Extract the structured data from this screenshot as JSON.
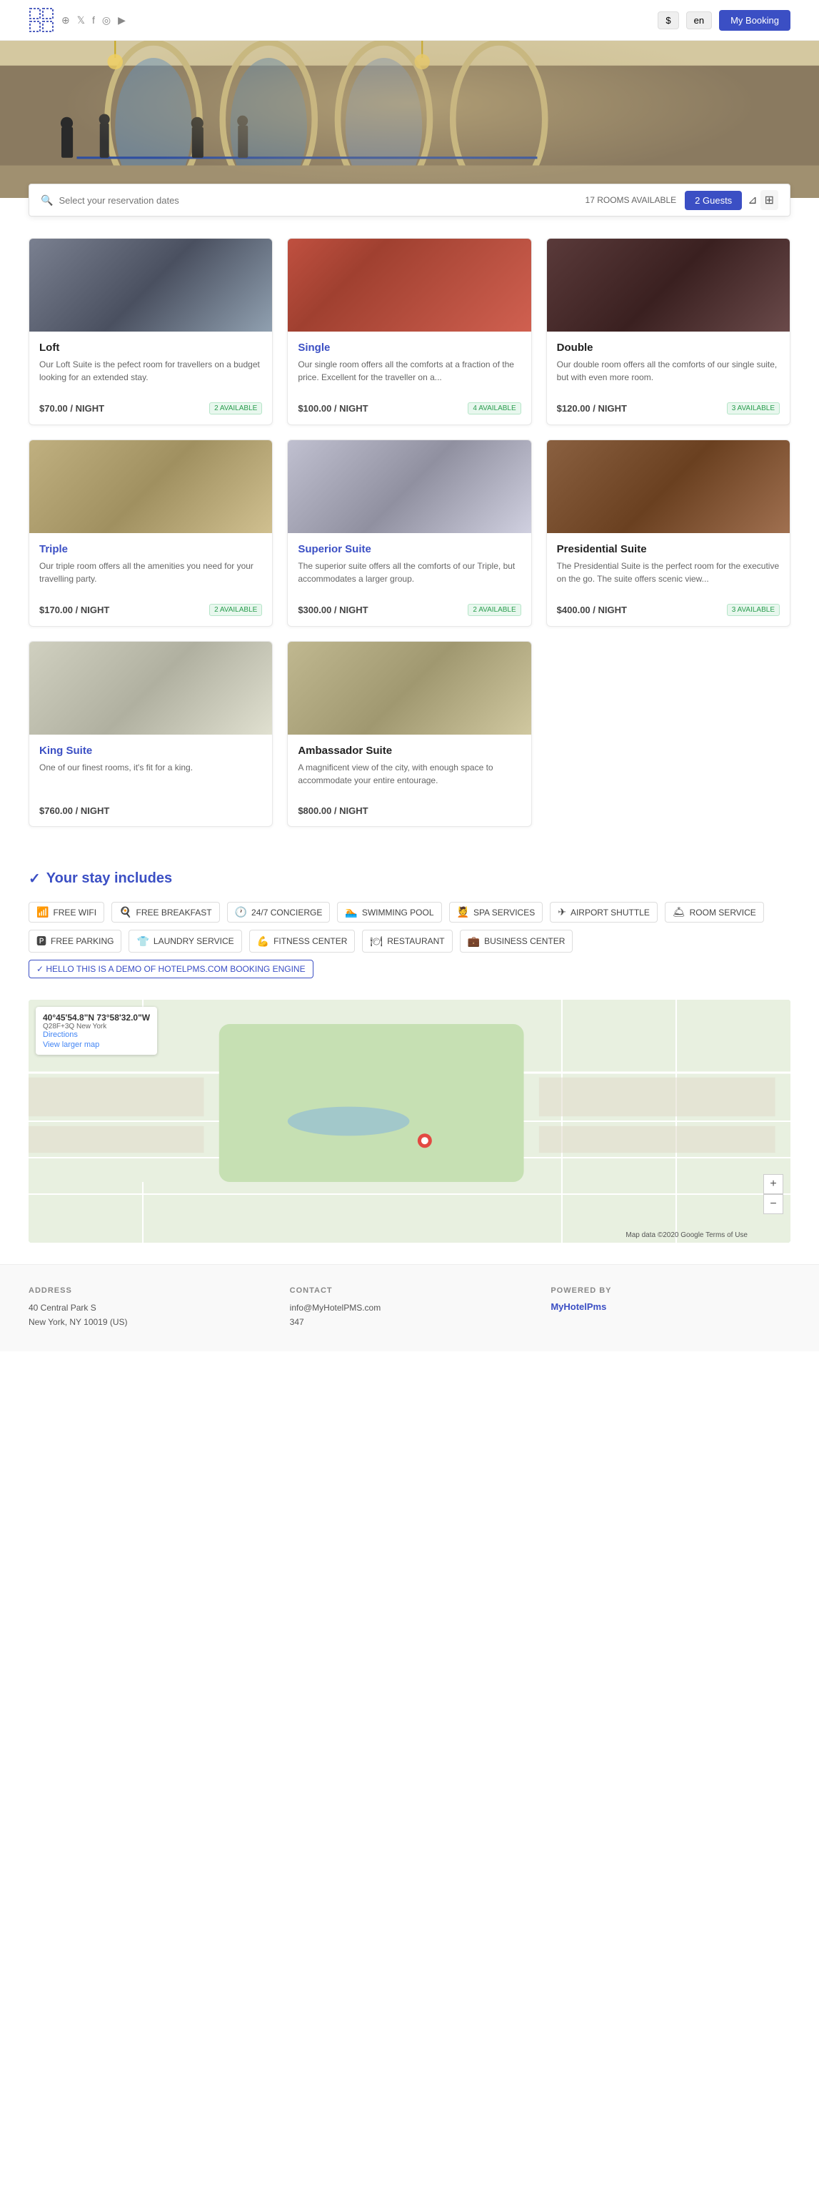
{
  "nav": {
    "currency": "$",
    "language": "en",
    "booking_btn": "My Booking",
    "social_icons": [
      "⊕",
      "𝕏",
      "f",
      "📷",
      "▶"
    ]
  },
  "search": {
    "placeholder": "Select your reservation dates",
    "rooms_available": "17 ROOMS AVAILABLE",
    "guests_btn": "2 Guests"
  },
  "rooms": [
    {
      "id": "loft",
      "title_plain": "Loft",
      "title_link": null,
      "is_link": false,
      "description": "Our Loft Suite is the pefect room for travellers on a budget looking for an extended stay.",
      "price": "$70.00 / NIGHT",
      "available": "2 AVAILABLE",
      "img_class": "img-loft"
    },
    {
      "id": "single",
      "title_plain": null,
      "title_link": "Single",
      "is_link": true,
      "description": "Our single room offers all the comforts at a fraction of the price. Excellent for the traveller on a...",
      "price": "$100.00 / NIGHT",
      "available": "4 AVAILABLE",
      "img_class": "img-single"
    },
    {
      "id": "double",
      "title_plain": "Double",
      "title_link": null,
      "is_link": false,
      "description": "Our double room offers all the comforts of our single suite, but with even more room.",
      "price": "$120.00 / NIGHT",
      "available": "3 AVAILABLE",
      "img_class": "img-double"
    },
    {
      "id": "triple",
      "title_plain": null,
      "title_link": "Triple",
      "is_link": true,
      "description": "Our triple room offers all the amenities you need for your travelling party.",
      "price": "$170.00 / NIGHT",
      "available": "2 AVAILABLE",
      "img_class": "img-triple"
    },
    {
      "id": "superior",
      "title_plain": null,
      "title_link": "Superior Suite",
      "is_link": true,
      "description": "The superior suite offers all the comforts of our Triple, but accommodates a larger group.",
      "price": "$300.00 / NIGHT",
      "available": "2 AVAILABLE",
      "img_class": "img-superior"
    },
    {
      "id": "presidential",
      "title_plain": "Presidential Suite",
      "title_link": null,
      "is_link": false,
      "description": "The Presidential Suite is the perfect room for the executive on the go. The suite offers scenic view...",
      "price": "$400.00 / NIGHT",
      "available": "3 AVAILABLE",
      "img_class": "img-presidential"
    },
    {
      "id": "king",
      "title_plain": null,
      "title_link": "King Suite",
      "is_link": true,
      "description": "One of our finest rooms, it's fit for a king.",
      "price": "$760.00 / NIGHT",
      "available": null,
      "img_class": "img-king"
    },
    {
      "id": "ambassador",
      "title_plain": "Ambassador Suite",
      "title_link": null,
      "is_link": false,
      "description": "A magnificent view of the city, with enough space to accommodate your entire entourage.",
      "price": "$800.00 / NIGHT",
      "available": null,
      "img_class": "img-ambassador"
    }
  ],
  "stay_includes": {
    "title": "Your stay includes",
    "amenities": [
      {
        "icon": "📶",
        "label": "FREE WIFI"
      },
      {
        "icon": "🍳",
        "label": "FREE BREAKFAST"
      },
      {
        "icon": "🕐",
        "label": "24/7 CONCIERGE"
      },
      {
        "icon": "🏊",
        "label": "SWIMMING POOL"
      },
      {
        "icon": "💆",
        "label": "SPA SERVICES"
      },
      {
        "icon": "✈",
        "label": "AIRPORT SHUTTLE"
      },
      {
        "icon": "🛎",
        "label": "ROOM SERVICE"
      },
      {
        "icon": "🅿",
        "label": "FREE PARKING"
      },
      {
        "icon": "👕",
        "label": "LAUNDRY SERVICE"
      },
      {
        "icon": "💪",
        "label": "FITNESS CENTER"
      },
      {
        "icon": "🍽",
        "label": "RESTAURANT"
      },
      {
        "icon": "💼",
        "label": "BUSINESS CENTER"
      }
    ],
    "demo_label": "✓ HELLO THIS IS A DEMO OF HOTELPMS.COM BOOKING ENGINE"
  },
  "map": {
    "coords": "40°45'54.8\"N 73°58'32.0\"W",
    "place_code": "Q28F+3Q New York",
    "directions_label": "Directions",
    "view_larger_label": "View larger map",
    "zoom_in": "+",
    "zoom_out": "−",
    "google_label": "Map data ©2020 Google  Terms of Use"
  },
  "footer": {
    "address_label": "ADDRESS",
    "address_lines": [
      "40 Central Park S",
      "New York, NY 10019 (US)"
    ],
    "contact_label": "CONTACT",
    "contact_lines": [
      "info@MyHotelPMS.com",
      "347"
    ],
    "powered_label": "POWERED BY",
    "powered_link": "MyHotelPms"
  }
}
